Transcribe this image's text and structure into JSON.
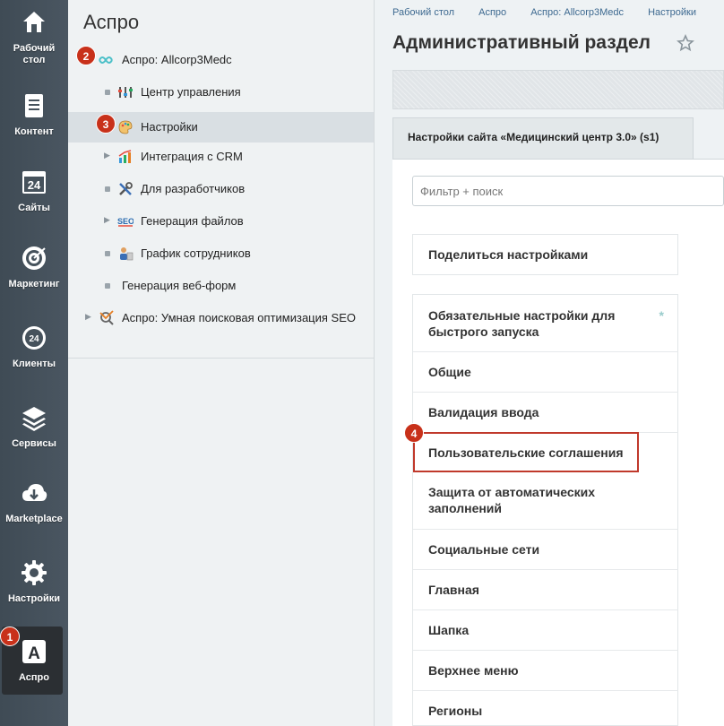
{
  "sidebar": {
    "items": [
      {
        "label_line1": "Рабочий",
        "label_line2": "стол",
        "icon": "home-icon"
      },
      {
        "label": "Контент",
        "icon": "document-icon"
      },
      {
        "label": "Сайты",
        "icon": "calendar-24-icon"
      },
      {
        "label": "Маркетинг",
        "icon": "target-icon"
      },
      {
        "label": "Клиенты",
        "icon": "clients-24-icon"
      },
      {
        "label": "Сервисы",
        "icon": "layers-icon"
      },
      {
        "label": "Marketplace",
        "icon": "cloud-download-icon"
      },
      {
        "label": "Настройки",
        "icon": "gear-icon"
      },
      {
        "label": "Аспро",
        "icon": "aspro-a-icon",
        "active": true
      }
    ]
  },
  "tree": {
    "title": "Аспро",
    "items": [
      {
        "label": "Аспро: Allcorp3Medc",
        "icon": "aspro-logo-icon"
      },
      {
        "label": "Центр управления",
        "icon": "control-panel-icon"
      },
      {
        "label": "Настройки",
        "icon": "palette-icon",
        "selected": true
      },
      {
        "label": "Интеграция с CRM",
        "icon": "chart-icon"
      },
      {
        "label": "Для разработчиков",
        "icon": "tools-icon"
      },
      {
        "label": "Генерация файлов",
        "icon": "seo-icon"
      },
      {
        "label": "График сотрудников",
        "icon": "employees-icon"
      },
      {
        "label": "Генерация веб-форм"
      },
      {
        "label": "Аспро: Умная поисковая оптимизация SEO",
        "icon": "seo-search-icon"
      }
    ]
  },
  "breadcrumbs": [
    "Рабочий стол",
    "Аспро",
    "Аспро: Allcorp3Medc",
    "Настройки"
  ],
  "page_title": "Административный раздел",
  "tab_label": "Настройки сайта «Медицинский центр 3.0» (s1)",
  "filter_placeholder": "Фильтр + поиск",
  "share_label": "Поделиться настройками",
  "settings_list": [
    {
      "line1": "Обязательные настройки для",
      "line2": "быстрого запуска",
      "required_mark": "*"
    },
    {
      "line1": "Общие"
    },
    {
      "line1": "Валидация ввода"
    },
    {
      "line1": "Пользовательские соглашения",
      "highlighted": true
    },
    {
      "line1": "Защита от автоматических",
      "line2": "заполнений"
    },
    {
      "line1": "Социальные сети"
    },
    {
      "line1": "Главная"
    },
    {
      "line1": "Шапка"
    },
    {
      "line1": "Верхнее меню"
    },
    {
      "line1": "Регионы"
    }
  ],
  "badges": [
    "1",
    "2",
    "3",
    "4"
  ],
  "colors": {
    "badge": "#c8311a",
    "highlight_border": "#c0392b",
    "link": "#3d6990"
  }
}
